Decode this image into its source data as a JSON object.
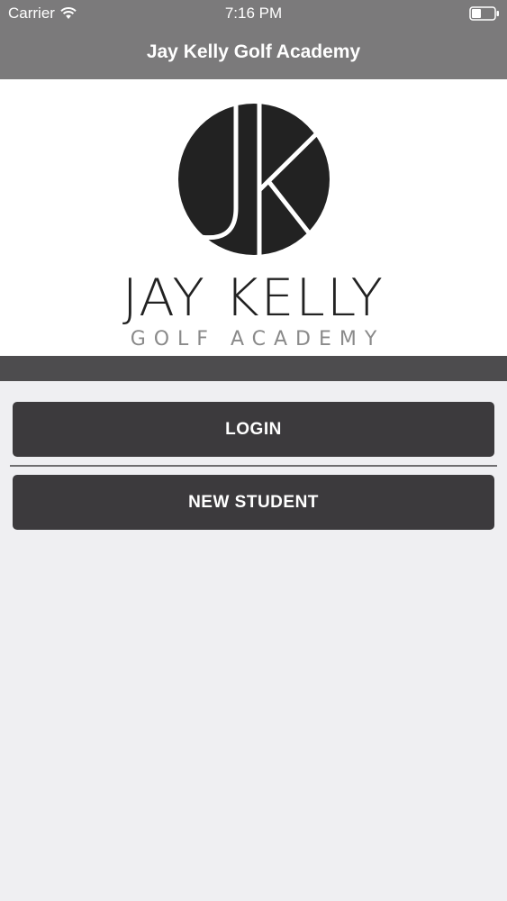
{
  "status_bar": {
    "carrier": "Carrier",
    "time": "7:16 PM",
    "icons": [
      "wifi-icon",
      "battery-icon"
    ]
  },
  "nav": {
    "title": "Jay Kelly Golf Academy"
  },
  "logo": {
    "monogram": "JK",
    "title": "JAY KELLY",
    "subtitle": "GOLF ACADEMY"
  },
  "actions": {
    "login_label": "LOGIN",
    "new_student_label": "NEW STUDENT"
  },
  "colors": {
    "nav_bar": "#7b7a7b",
    "band": "#4d4c4e",
    "button": "#3c3a3d",
    "background": "#efeff2"
  }
}
